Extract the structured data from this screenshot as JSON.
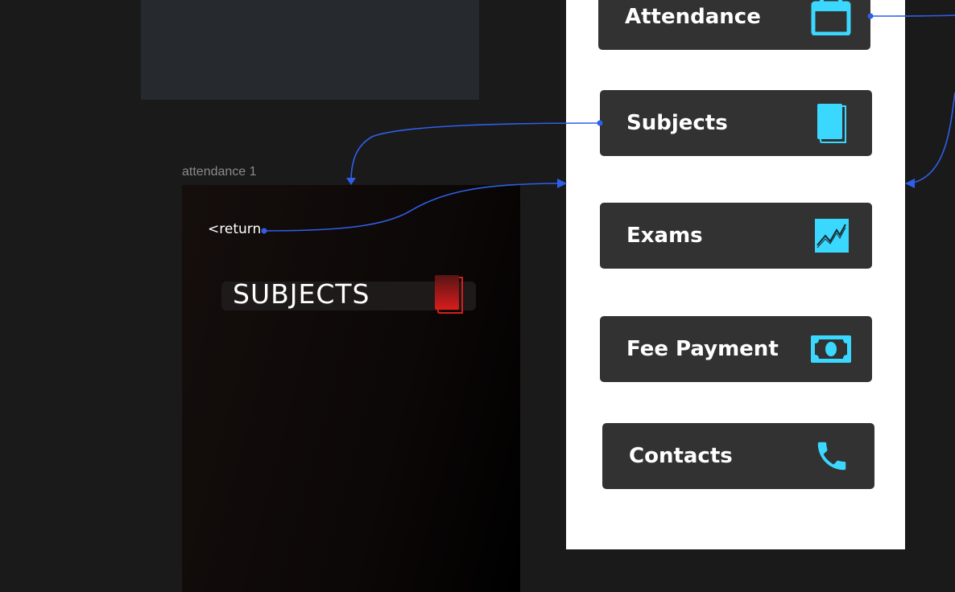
{
  "frames": {
    "attendance_label": "attendance 1",
    "return_label": "<return",
    "subjects_heading": "SUBJECTS"
  },
  "menu": {
    "items": [
      {
        "label": "Attendance",
        "icon": "calendar-icon"
      },
      {
        "label": "Subjects",
        "icon": "book-icon"
      },
      {
        "label": "Exams",
        "icon": "chart-icon"
      },
      {
        "label": "Fee Payment",
        "icon": "money-icon"
      },
      {
        "label": "Contacts",
        "icon": "phone-icon"
      }
    ]
  },
  "colors": {
    "background": "#1a1a1b",
    "panel": "#ffffff",
    "button": "#323232",
    "accent_cyan": "#3ad8ff",
    "connector_blue": "#2f5fe8",
    "subjects_red": "#d11c1c"
  }
}
